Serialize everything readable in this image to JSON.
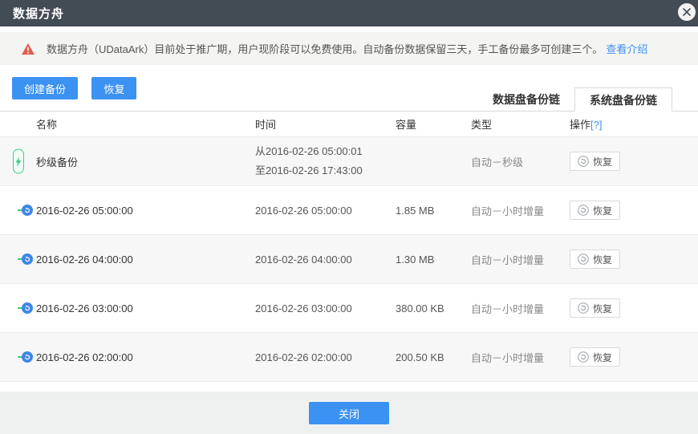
{
  "header": {
    "title": "数据方舟"
  },
  "notice": {
    "text": "数据方舟（UDataArk）目前处于推广期，用户现阶段可以免费使用。自动备份数据保留三天，手工备份最多可创建三个。",
    "link": "查看介绍"
  },
  "toolbar": {
    "create_label": "创建备份",
    "restore_label": "恢复"
  },
  "tabs": [
    {
      "label": "数据盘备份链",
      "active": false
    },
    {
      "label": "系统盘备份链",
      "active": true
    }
  ],
  "table": {
    "columns": {
      "name": "名称",
      "time": "时间",
      "capacity": "容量",
      "type": "类型",
      "action": "操作",
      "action_help": "[?]"
    },
    "rows": [
      {
        "name": "秒级备份",
        "time_from": "从2016-02-26 05:00:01",
        "time_to": "至2016-02-26 17:43:00",
        "capacity": "",
        "type": "自动－秒级",
        "action": "恢复"
      },
      {
        "name": "2016-02-26 05:00:00",
        "time": "2016-02-26 05:00:00",
        "capacity": "1.85 MB",
        "type": "自动－小时增量",
        "action": "恢复"
      },
      {
        "name": "2016-02-26 04:00:00",
        "time": "2016-02-26 04:00:00",
        "capacity": "1.30 MB",
        "type": "自动－小时增量",
        "action": "恢复"
      },
      {
        "name": "2016-02-26 03:00:00",
        "time": "2016-02-26 03:00:00",
        "capacity": "380.00 KB",
        "type": "自动－小时增量",
        "action": "恢复"
      },
      {
        "name": "2016-02-26 02:00:00",
        "time": "2016-02-26 02:00:00",
        "capacity": "200.50 KB",
        "type": "自动－小时增量",
        "action": "恢复"
      }
    ]
  },
  "footer": {
    "close_label": "关闭"
  },
  "colors": {
    "accent_blue": "#3b92f2",
    "timeline_green": "#3ecb8b",
    "warning_red": "#e05c50",
    "header_bg": "#434b55"
  }
}
